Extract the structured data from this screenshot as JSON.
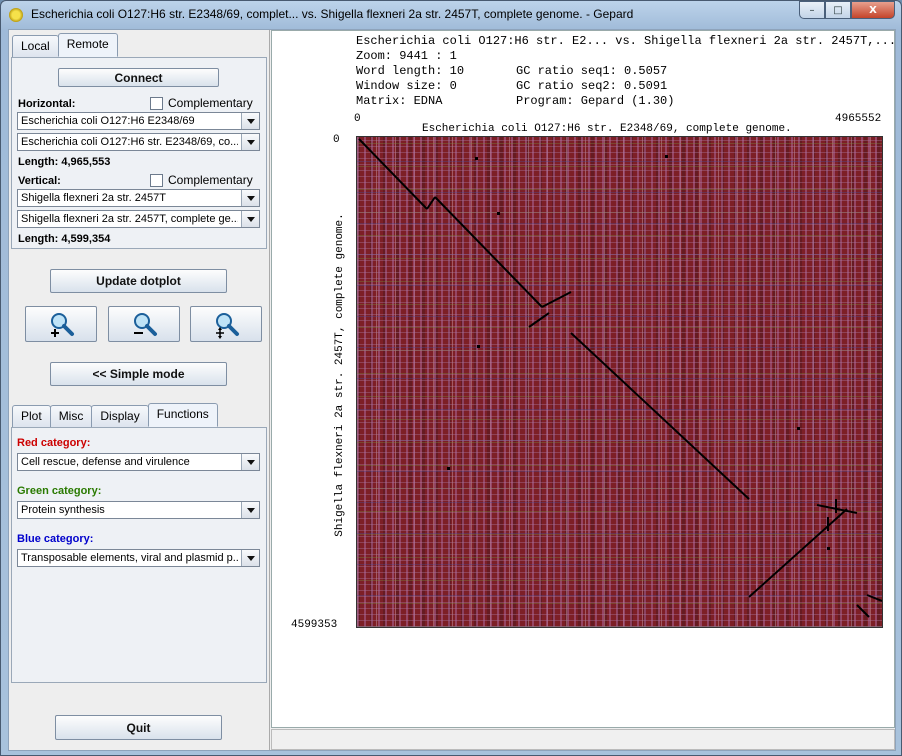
{
  "window": {
    "title": "Escherichia coli O127:H6 str. E2348/69, complet...  vs.  Shigella flexneri 2a str. 2457T, complete genome.  -  Gepard",
    "controls": [
      "–",
      "□",
      "X"
    ]
  },
  "source_tabs": [
    {
      "label": "Local",
      "active": false
    },
    {
      "label": "Remote",
      "active": true
    }
  ],
  "remote": {
    "connect_label": "Connect",
    "horizontal_label": "Horizontal:",
    "complementary_label": "Complementary",
    "horizontal_organism": "Escherichia coli O127:H6 E2348/69",
    "horizontal_sequence": "Escherichia coli O127:H6 str. E2348/69, co...",
    "horizontal_length": "Length: 4,965,553",
    "vertical_label": "Vertical:",
    "vertical_organism": "Shigella flexneri 2a str. 2457T",
    "vertical_sequence": "Shigella flexneri 2a str. 2457T, complete ge...",
    "vertical_length": "Length: 4,599,354"
  },
  "actions": {
    "update_label": "Update dotplot",
    "simple_mode_label": "<< Simple mode",
    "quit_label": "Quit"
  },
  "options_tabs": [
    {
      "label": "Plot",
      "active": false
    },
    {
      "label": "Misc",
      "active": false
    },
    {
      "label": "Display",
      "active": false
    },
    {
      "label": "Functions",
      "active": true
    }
  ],
  "functions": {
    "red_label": "Red category:",
    "red_value": "Cell rescue, defense and virulence",
    "green_label": "Green category:",
    "green_value": "Protein synthesis",
    "blue_label": "Blue category:",
    "blue_value": "Transposable elements, viral and plasmid p...",
    "red_color": "#cc0000",
    "green_color": "#2a7a00",
    "blue_color": "#0000cc"
  },
  "plot_info": {
    "header": "Escherichia coli O127:H6 str. E2... vs. Shigella flexneri 2a str. 2457T,...",
    "zoom": "Zoom: 9441 : 1",
    "word_length": "Word length: 10",
    "window_size": "Window size: 0",
    "matrix": "Matrix: EDNA",
    "gc1": "GC ratio seq1: 0.5057",
    "gc2": "GC ratio seq2: 0.5091",
    "program": "Program: Gepard (1.30)"
  },
  "axes": {
    "x_start": "0",
    "x_end": "4965552",
    "x_title": "Escherichia coli O127:H6 str. E2348/69, complete genome.",
    "y_start": "0",
    "y_end": "4599353",
    "y_title": "Shigella flexneri 2a str. 2457T, complete genome."
  }
}
